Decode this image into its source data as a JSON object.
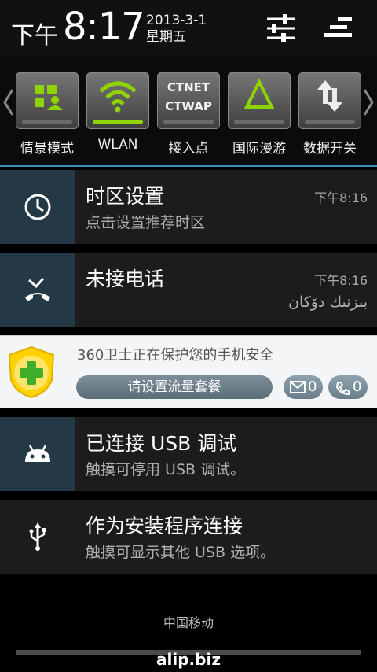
{
  "status_bar": {
    "ampm": "下午",
    "time": "8:17",
    "date": "2013-3-1",
    "weekday": "星期五",
    "icons": [
      "sliders-icon",
      "clear-notifications-icon"
    ]
  },
  "toggles": [
    {
      "label": "情景模式",
      "icon": "profile-mode-icon",
      "active": false
    },
    {
      "label": "WLAN",
      "icon": "wifi-icon",
      "active": true
    },
    {
      "label": "接入点",
      "icon": "apn-icon",
      "line1": "CTNET",
      "line2": "CTWAP",
      "active": false
    },
    {
      "label": "国际漫游",
      "icon": "roaming-icon",
      "active": false
    },
    {
      "label": "数据开关",
      "icon": "data-toggle-icon",
      "active": false
    }
  ],
  "notifications": [
    {
      "title": "时区设置",
      "subtitle": "点击设置推荐时区",
      "time": "下午8:16",
      "icon": "clock-icon"
    },
    {
      "title": "未接电话",
      "subtitle": "بىزنىك دۆكان",
      "time": "下午8:16",
      "icon": "missed-call-icon"
    }
  ],
  "security_360": {
    "title": "360卫士正在保护您的手机安全",
    "button_label": "请设置流量套餐",
    "sms_count": "0",
    "call_count": "0",
    "icons": [
      "360-logo-icon",
      "sms-icon",
      "phone-icon"
    ]
  },
  "usb_notifications": [
    {
      "title": "已连接 USB 调试",
      "subtitle": "触摸可停用 USB 调试。",
      "icon": "android-icon"
    },
    {
      "title": "作为安装程序连接",
      "subtitle": "触摸可显示其他 USB 选项。",
      "icon": "usb-icon"
    }
  ],
  "carrier": "中国移动",
  "watermark": "alip.biz",
  "colors": {
    "accent_green": "#8fd400",
    "separator_blue": "#3a8fb8",
    "icon_box": "#253845"
  }
}
